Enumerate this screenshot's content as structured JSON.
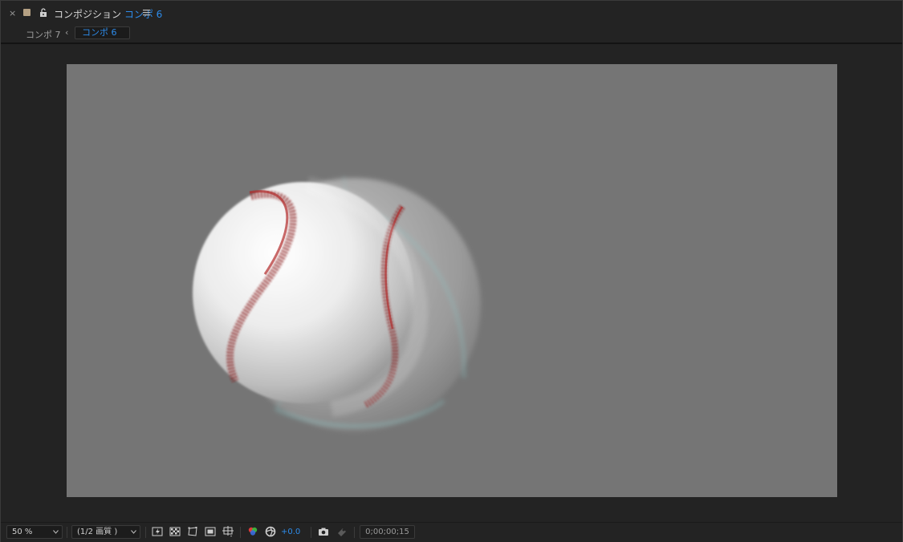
{
  "panel": {
    "close_symbol": "×",
    "tab_prefix": "コンポジション",
    "tab_name": "コンポ 6",
    "label_color": "#b4a083",
    "accent_color": "#2d8ceb"
  },
  "breadcrumb": {
    "parent": "コンポ 7",
    "arrow": "‹",
    "current": "コンポ 6"
  },
  "icons": {
    "close": "close-icon",
    "label_swatch": "label-color-swatch",
    "lock": "lock-open-icon",
    "menu": "hamburger-menu-icon",
    "fast_previews": "fast-previews-icon",
    "transparency_grid": "transparency-grid-icon",
    "mask_visibility": "mask-path-visibility-icon",
    "region_of_interest": "region-of-interest-icon",
    "grid_guides": "grid-guides-icon",
    "channels": "rgb-channels-icon",
    "color_management": "color-management-icon",
    "snapshot": "camera-snapshot-icon",
    "show_snapshot": "show-snapshot-icon"
  },
  "viewer": {
    "background_color": "#757575",
    "content": "baseball-motion-blur"
  },
  "toolbar": {
    "zoom": "50 %",
    "resolution": "(1/2 画質 )",
    "exposure": "+0.0",
    "timecode": "0;00;00;15"
  }
}
